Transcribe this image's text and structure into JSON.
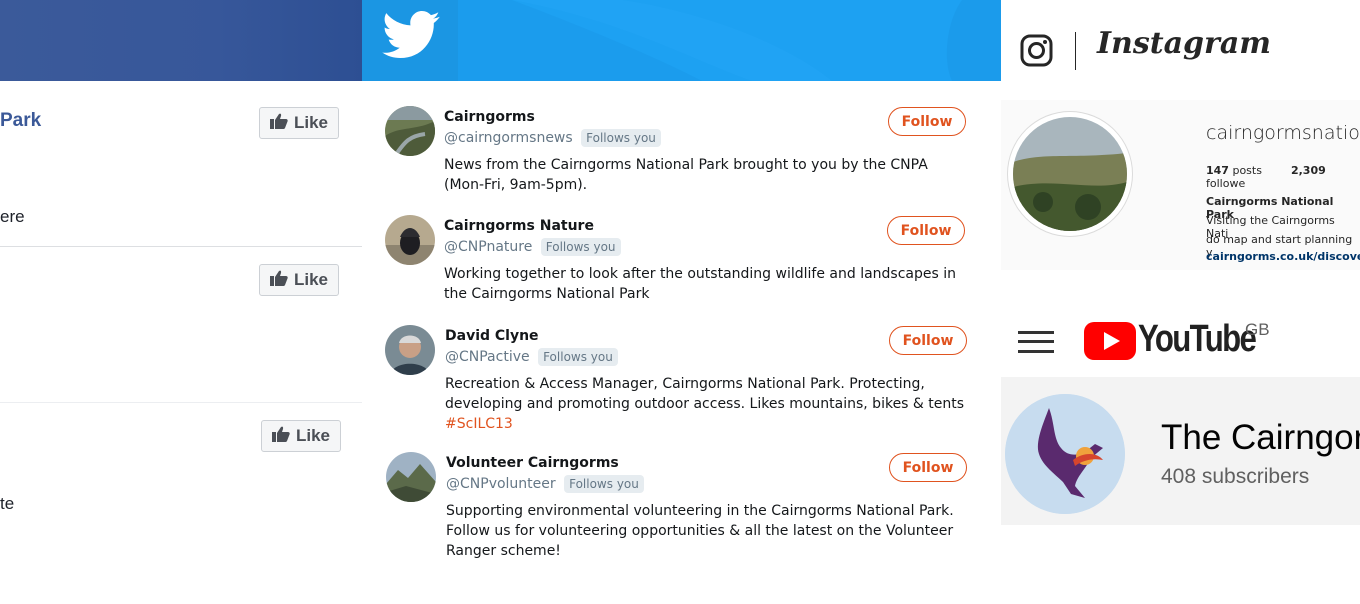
{
  "facebook": {
    "page_title_fragment": "Park",
    "text_fragment_1": "ere",
    "text_fragment_2": "te",
    "like_label": "Like"
  },
  "twitter": {
    "accounts": [
      {
        "name": "Cairngorms",
        "handle": "@cairngormsnews",
        "follows_you": "Follows you",
        "bio": "News from the Cairngorms National Park brought to you by the CNPA (Mon-Fri, 9am-5pm).",
        "button": "Follow"
      },
      {
        "name": "Cairngorms Nature",
        "handle": "@CNPnature",
        "follows_you": "Follows you",
        "bio": "Working together to look after the outstanding wildlife and landscapes in the Cairngorms National Park",
        "button": "Follow"
      },
      {
        "name": "David Clyne",
        "handle": "@CNPactive",
        "follows_you": "Follows you",
        "bio": "Recreation & Access Manager, Cairngorms National Park. Protecting, developing and promoting outdoor access. Likes mountains, bikes & tents",
        "hashtag": "#ScILC13",
        "button": "Follow"
      },
      {
        "name": "Volunteer Cairngorms",
        "handle": "@CNPvolunteer",
        "follows_you": "Follows you",
        "bio": "Supporting environmental volunteering in the Cairngorms National Park. Follow us for volunteering opportunities & all the latest on the Volunteer Ranger scheme!",
        "button": "Follow"
      }
    ]
  },
  "instagram": {
    "wordmark": "Instagram",
    "username": "cairngormsnation",
    "posts_count": "147",
    "posts_label": "posts",
    "followers_count": "2,309",
    "followers_label": "followe",
    "profile_name": "Cairngorms National Park",
    "bio_line_1": "Visiting the Cairngorms Nati",
    "bio_line_2": "do map and start planning y",
    "link": "cairngorms.co.uk/discover-"
  },
  "youtube": {
    "wordmark": "YouTube",
    "region": "GB",
    "channel_name": "The Cairngor",
    "subscribers": "408 subscribers"
  },
  "colors": {
    "facebook_blue": "#3b5998",
    "twitter_blue": "#1da1f2",
    "follow_orange": "#e0531f",
    "youtube_red": "#ff0000"
  }
}
